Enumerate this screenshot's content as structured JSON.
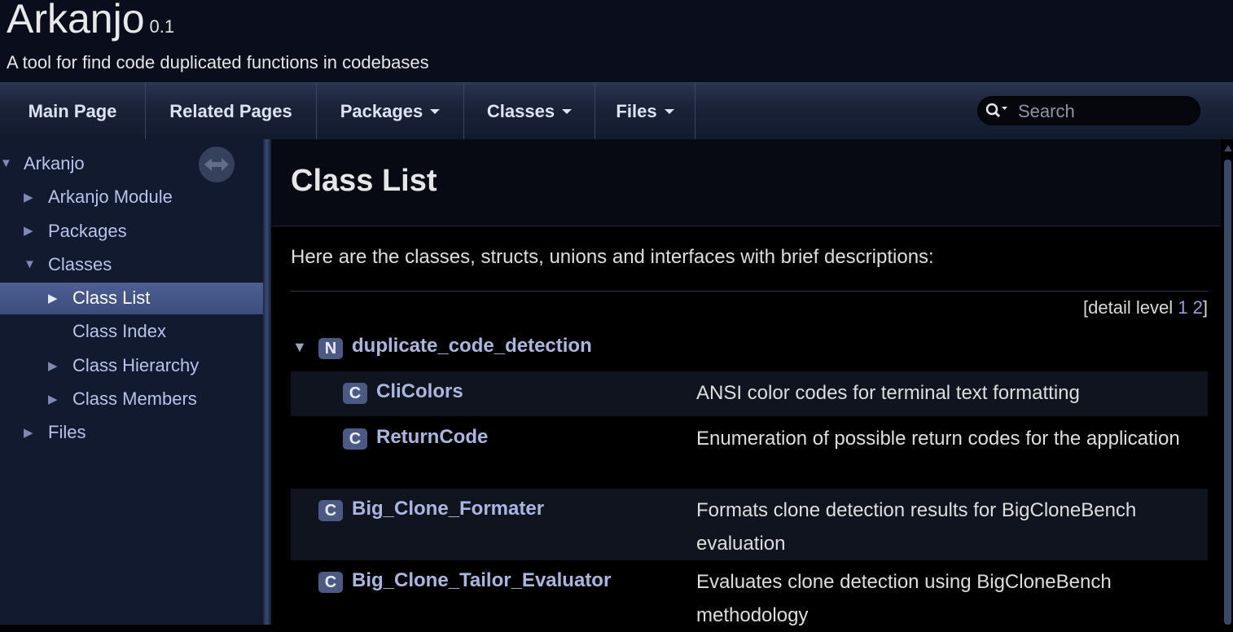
{
  "header": {
    "project_name": "Arkanjo",
    "project_number": "0.1",
    "project_brief": "A tool for find code duplicated functions in codebases"
  },
  "nav": {
    "items": [
      {
        "label": "Main Page",
        "has_menu": false
      },
      {
        "label": "Related Pages",
        "has_menu": false
      },
      {
        "label": "Packages",
        "has_menu": true
      },
      {
        "label": "Classes",
        "has_menu": true
      },
      {
        "label": "Files",
        "has_menu": true
      }
    ],
    "search_placeholder": "Search"
  },
  "sidebar": {
    "root": "Arkanjo",
    "items": [
      {
        "label": "Arkanjo Module"
      },
      {
        "label": "Packages"
      },
      {
        "label": "Classes",
        "expanded": true
      },
      {
        "label": "Class List",
        "selected": true
      },
      {
        "label": "Class Index"
      },
      {
        "label": "Class Hierarchy"
      },
      {
        "label": "Class Members"
      },
      {
        "label": "Files"
      }
    ]
  },
  "content": {
    "title": "Class List",
    "intro": "Here are the classes, structs, unions and interfaces with brief descriptions:",
    "detail_level_label": "[detail level",
    "detail_levels": [
      "1",
      "2"
    ],
    "detail_level_close": "]",
    "entries": [
      {
        "badge": "N",
        "name": "duplicate_code_detection",
        "desc": ""
      },
      {
        "badge": "C",
        "name": "CliColors",
        "desc": "ANSI color codes for terminal text formatting"
      },
      {
        "badge": "C",
        "name": "ReturnCode",
        "desc": "Enumeration of possible return codes for the application"
      },
      {
        "badge": "C",
        "name": "Big_Clone_Formater",
        "desc": "Formats clone detection results for BigCloneBench evaluation"
      },
      {
        "badge": "C",
        "name": "Big_Clone_Tailor_Evaluator",
        "desc": "Evaluates clone detection using BigCloneBench methodology"
      }
    ]
  },
  "colors": {
    "header_bg": "#0a0e1c",
    "sidebar_bg": "#111a2e",
    "selected_bg": "#4d5f94",
    "link": "#a9b6e0",
    "badge_bg": "#4a5a85"
  }
}
